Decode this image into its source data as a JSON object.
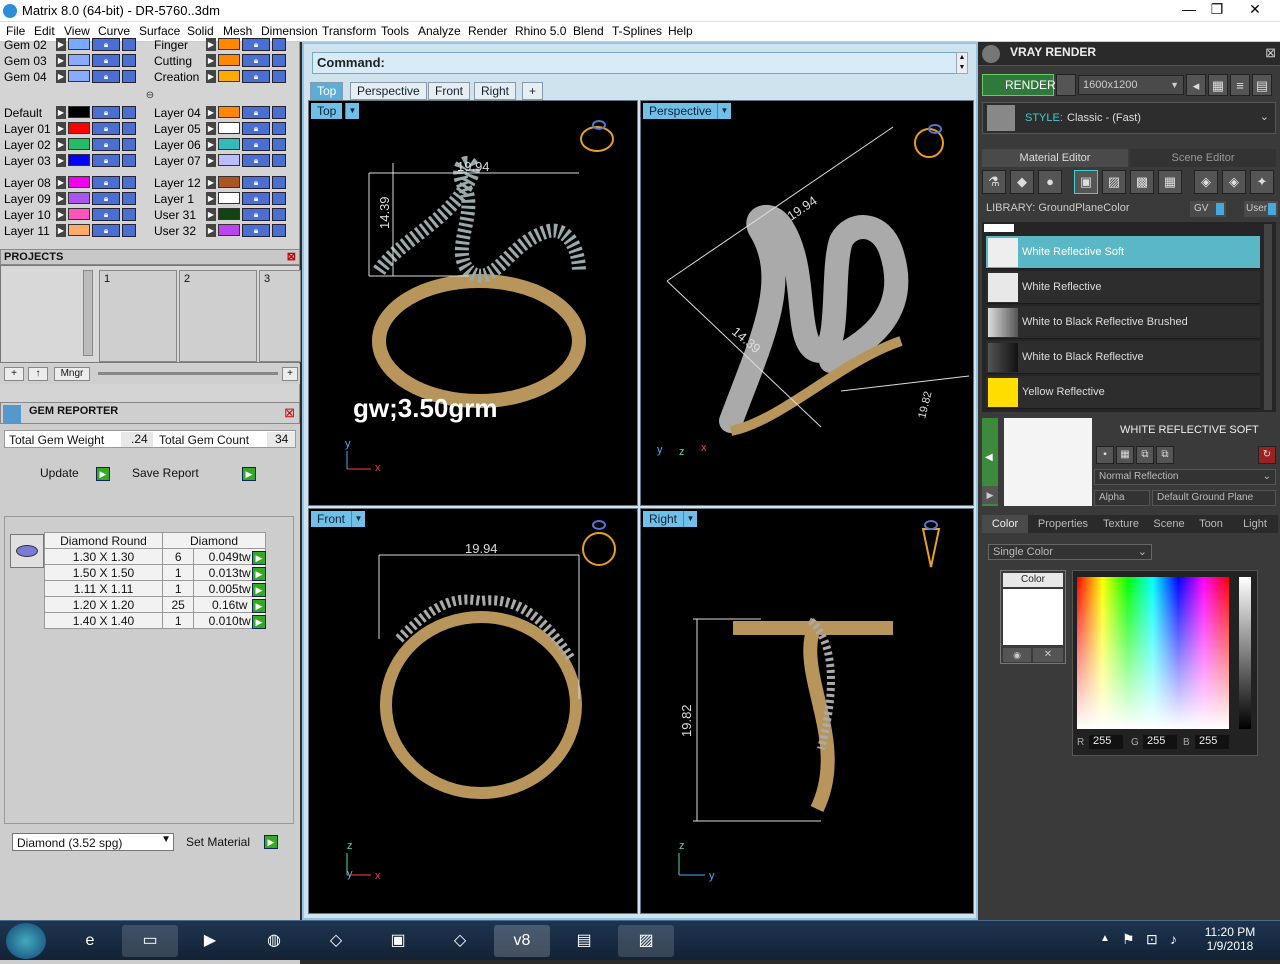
{
  "window": {
    "title": "Matrix 8.0 (64-bit) - DR-5760..3dm",
    "min": "—",
    "max": "❐",
    "close": "✕"
  },
  "menu": [
    "File",
    "Edit",
    "View",
    "Curve",
    "Surface",
    "Solid",
    "Mesh",
    "Dimension",
    "Transform",
    "Tools",
    "Analyze",
    "Render",
    "Rhino 5.0",
    "Blend",
    "T-Splines",
    "Help"
  ],
  "layers_top": [
    {
      "name": "Gem 02",
      "color": "#7aaaff",
      "name2": "Finger",
      "color2": "#ff8800"
    },
    {
      "name": "Gem 03",
      "color": "#88aaff",
      "name2": "Cutting",
      "color2": "#ff8800"
    },
    {
      "name": "Gem 04",
      "color": "#88aaff",
      "name2": "Creation",
      "color2": "#ffaa00"
    }
  ],
  "layers_mid": [
    {
      "name": "Default",
      "color": "#000000",
      "name2": "Layer 04",
      "color2": "#ff8800"
    },
    {
      "name": "Layer 01",
      "color": "#ff0000",
      "name2": "Layer 05",
      "color2": "#ffffff"
    },
    {
      "name": "Layer 02",
      "color": "#22bb66",
      "name2": "Layer 06",
      "color2": "#33bbbb"
    },
    {
      "name": "Layer 03",
      "color": "#0000ff",
      "name2": "Layer 07",
      "color2": "#bbbbff"
    }
  ],
  "layers_bot": [
    {
      "name": "Layer 08",
      "color": "#ee00ee",
      "name2": "Layer 12",
      "color2": "#aa5522"
    },
    {
      "name": "Layer 09",
      "color": "#aa55ee",
      "name2": "Layer 1",
      "color2": "#ffffff"
    },
    {
      "name": "Layer 10",
      "color": "#ff55bb",
      "name2": "User 31",
      "color2": "#114411"
    },
    {
      "name": "Layer 11",
      "color": "#ffaa66",
      "name2": "User 32",
      "color2": "#bb44ee"
    }
  ],
  "projects": {
    "title": "PROJECTS",
    "slots": [
      "1",
      "2",
      "3"
    ],
    "mngr": "Mngr"
  },
  "gem_reporter": {
    "title": "GEM REPORTER",
    "weight_label": "Total Gem Weight",
    "weight_value": ".24",
    "count_label": "Total Gem Count",
    "count_value": "34",
    "update": "Update",
    "save": "Save Report",
    "headers": [
      "Diamond Round",
      "Diamond"
    ],
    "rows": [
      {
        "size": "1.30 X 1.30",
        "qty": "6",
        "wt": "0.049tw"
      },
      {
        "size": "1.50 X 1.50",
        "qty": "1",
        "wt": "0.013tw"
      },
      {
        "size": "1.11 X 1.11",
        "qty": "1",
        "wt": "0.005tw"
      },
      {
        "size": "1.20 X 1.20",
        "qty": "25",
        "wt": "0.16tw"
      },
      {
        "size": "1.40 X 1.40",
        "qty": "1",
        "wt": "0.010tw"
      }
    ],
    "material_select": "Diamond    (3.52 spg)",
    "set_material": "Set Material"
  },
  "command": {
    "label": "Command:"
  },
  "view_tabs": [
    "Top",
    "Perspective",
    "Front",
    "Right",
    "+"
  ],
  "viewports": {
    "top": {
      "label": "Top",
      "dim_w": "19.94",
      "dim_h": "14.39",
      "note": "gw;3.50grm",
      "ax1": "y",
      "ax2": "x"
    },
    "persp": {
      "label": "Perspective",
      "dim_a": "19.94",
      "dim_b": "14.39",
      "dim_c": "19.82",
      "ax1": "y",
      "ax2": "z",
      "ax3": "x"
    },
    "front": {
      "label": "Front",
      "dim_w": "19.94",
      "ax1": "z",
      "ax2": "y",
      "ax3": "x"
    },
    "right": {
      "label": "Right",
      "dim_h": "19.82",
      "ax1": "z",
      "ax2": "y"
    }
  },
  "vray": {
    "title": "VRAY RENDER",
    "render": "RENDER",
    "resolution": "1600x1200",
    "style_label": "STYLE:",
    "style_value": "Classic - (Fast)",
    "tabs": [
      "Material Editor",
      "Scene Editor"
    ],
    "library_label": "LIBRARY: GroundPlaneColor",
    "gv": "GV",
    "user": "User",
    "materials": [
      {
        "name": "White Reflective Soft",
        "selected": true
      },
      {
        "name": "White Reflective",
        "selected": false
      },
      {
        "name": "White to Black Reflective Brushed",
        "selected": false
      },
      {
        "name": "White to Black Reflective",
        "selected": false
      },
      {
        "name": "Yellow Reflective",
        "selected": false
      }
    ],
    "selected_title": "WHITE REFLECTIVE SOFT",
    "reflection": "Normal Reflection",
    "alpha": "Alpha",
    "ground": "Default Ground Plane",
    "prop_tabs": [
      "Color",
      "Properties",
      "Texture",
      "Scene",
      "Toon",
      "Light"
    ],
    "color_mode": "Single Color",
    "color_label": "Color",
    "r_label": "R",
    "r": "255",
    "g_label": "G",
    "g": "255",
    "b_label": "B",
    "b": "255"
  },
  "taskbar": {
    "time": "11:20 PM",
    "date": "1/9/2018"
  }
}
